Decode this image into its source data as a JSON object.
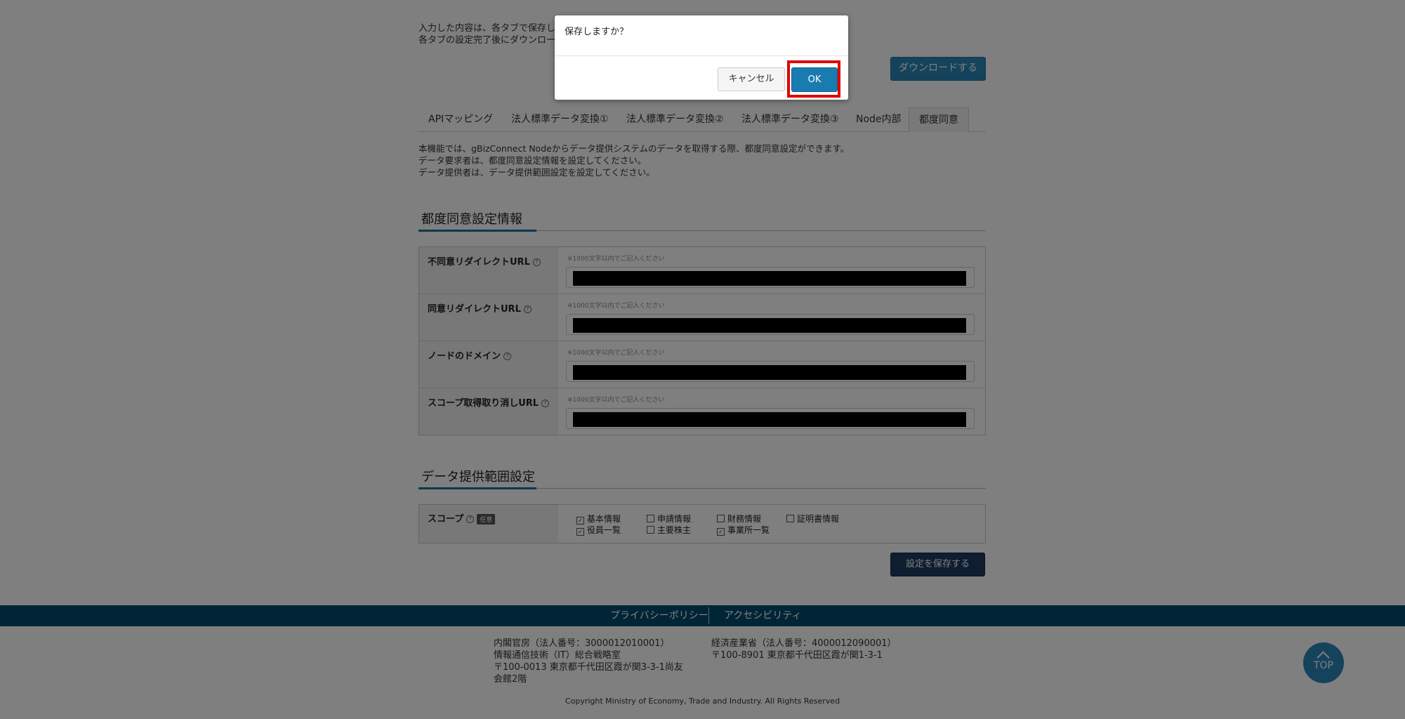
{
  "intro": {
    "line1": "入力した内容は、各タブで保存して",
    "line2": "各タブの設定完了後にダウンロード"
  },
  "download_button": "ダウンロードする",
  "tabs": [
    {
      "label": "APIマッピング"
    },
    {
      "label": "法人標準データ変換①"
    },
    {
      "label": "法人標準データ変換②"
    },
    {
      "label": "法人標準データ変換③"
    },
    {
      "label": "Node内部"
    },
    {
      "label": "都度同意",
      "active": true
    }
  ],
  "description": {
    "line1": "本機能では、gBizConnect Nodeからデータ提供システムのデータを取得する際、都度同意設定ができます。",
    "line2": "データ要求者は、都度同意設定情報を設定してください。",
    "line3": "データ提供者は、データ提供範囲設定を設定してください。"
  },
  "section1_title": "都度同意設定情報",
  "fields": [
    {
      "label": "不同意リダイレクトURL",
      "hint": "※1000文字以内でご記入ください"
    },
    {
      "label": "同意リダイレクトURL",
      "hint": "※1000文字以内でご記入ください"
    },
    {
      "label": "ノードのドメイン",
      "hint": "※1000文字以内でご記入ください"
    },
    {
      "label": "スコープ取得取り消しURL",
      "hint": "※1000文字以内でご記入ください"
    }
  ],
  "section2_title": "データ提供範囲設定",
  "scope": {
    "label": "スコープ",
    "badge": "任意",
    "options": [
      {
        "label": "基本情報",
        "checked": true
      },
      {
        "label": "申請情報",
        "checked": false
      },
      {
        "label": "財務情報",
        "checked": false
      },
      {
        "label": "証明書情報",
        "checked": false
      },
      {
        "label": "役員一覧",
        "checked": true
      },
      {
        "label": "主要株主",
        "checked": false
      },
      {
        "label": "事業所一覧",
        "checked": true
      }
    ]
  },
  "save_button": "設定を保存する",
  "footer": {
    "privacy": "プライバシーポリシー",
    "accessibility": "アクセシビリティ",
    "org1": {
      "line1": "内閣官房（法人番号：3000012010001）",
      "line2": "情報通信技術（IT）総合戦略室",
      "line3": "〒100-0013 東京都千代田区霞が関3-3-1尚友",
      "line4": "会館2階"
    },
    "org2": {
      "line1": "経済産業省（法人番号：4000012090001）",
      "line2": "〒100-8901 東京都千代田区霞が関1-3-1"
    },
    "copyright": "Copyright Ministry of Economy, Trade and Industry. All Rights Reserved",
    "top_label": "TOP"
  },
  "dialog": {
    "message": "保存しますか？",
    "cancel": "キャンセル",
    "ok": "OK"
  },
  "icons": {
    "help": "question-icon",
    "top_arrow": "chevron-up-icon",
    "check": "checkmark-icon"
  },
  "colors": {
    "accent": "#2a86b8",
    "footer": "#004a6d",
    "save_button": "#1e3b63",
    "highlight": "#e00000"
  }
}
